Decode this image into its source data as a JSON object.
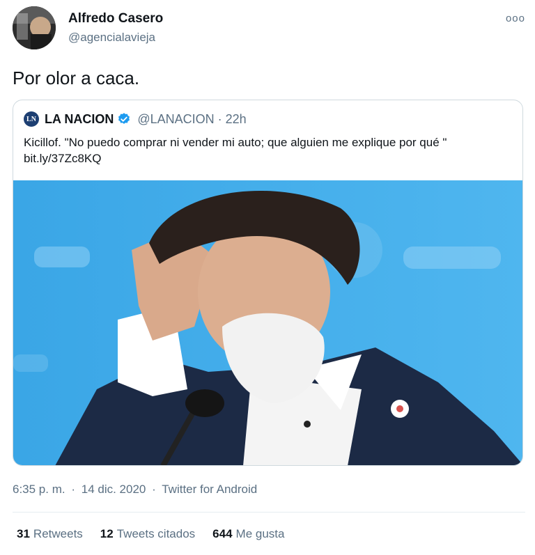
{
  "author": {
    "name": "Alfredo Casero",
    "handle": "@agencialavieja"
  },
  "more_icon": "ooo",
  "tweet": {
    "text": "Por olor a caca."
  },
  "quoted": {
    "logo_text": "LN",
    "name": "LA NACION",
    "handle": "@LANACION",
    "separator": "·",
    "time": "22h",
    "text": "Kicillof. \"No puedo comprar ni vender mi auto; que alguien me explique por qué \" bit.ly/37Zc8KQ",
    "verified_color": "#1d9bf0"
  },
  "meta": {
    "time": "6:35 p. m.",
    "sep1": "·",
    "date": "14 dic. 2020",
    "sep2": "·",
    "source": "Twitter for Android"
  },
  "stats": {
    "retweets_count": "31",
    "retweets_label": "Retweets",
    "quotes_count": "12",
    "quotes_label": "Tweets citados",
    "likes_count": "644",
    "likes_label": "Me gusta"
  }
}
